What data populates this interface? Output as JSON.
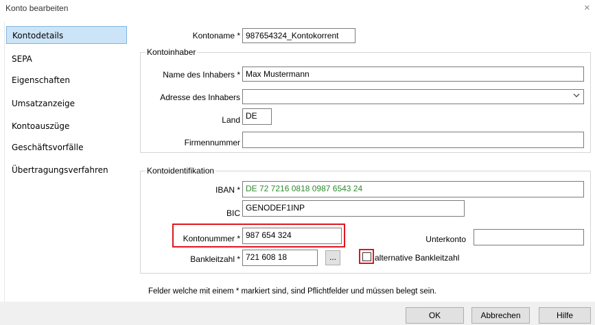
{
  "window": {
    "title": "Konto bearbeiten",
    "close_label": "×"
  },
  "sidebar": {
    "items": [
      {
        "label": "Kontodetails",
        "active": true
      },
      {
        "label": "SEPA"
      },
      {
        "label": "Eigenschaften"
      },
      {
        "label": "Umsatzanzeige"
      },
      {
        "label": "Kontoauszüge"
      },
      {
        "label": "Geschäftsvorfälle"
      },
      {
        "label": "Übertragungsverfahren"
      }
    ]
  },
  "form": {
    "kontoname": {
      "label": "Kontoname *",
      "value": "987654324_Kontokorrent"
    },
    "kontoinhaber": {
      "legend": "Kontoinhaber",
      "name": {
        "label": "Name des Inhabers *",
        "value": "Max Mustermann"
      },
      "adresse": {
        "label": "Adresse des Inhabers",
        "value": "",
        "dropdown_icon": "chevron-down-icon"
      },
      "land": {
        "label": "Land",
        "value": "DE"
      },
      "firmennummer": {
        "label": "Firmennummer",
        "value": ""
      }
    },
    "kontoidentifikation": {
      "legend": "Kontoidentifikation",
      "iban": {
        "label": "IBAN *",
        "value": "DE 72 7216 0818 0987 6543 24",
        "color": "#2e8b2e"
      },
      "bic": {
        "label": "BIC",
        "value": "GENODEF1INP"
      },
      "kontonummer": {
        "label": "Kontonummer *",
        "value": "987 654 324"
      },
      "unterkonto": {
        "label": "Unterkonto",
        "value": ""
      },
      "bankleitzahl": {
        "label": "Bankleitzahl *",
        "value": "721 608 18",
        "browse_label": "..."
      },
      "alternative_blz": {
        "label": "alternative Bankleitzahl",
        "checked": false
      }
    },
    "note": "Felder welche mit einem * markiert sind, sind Pflichtfelder und müssen belegt sein."
  },
  "highlight_color": "#e0141c",
  "buttons": {
    "ok": "OK",
    "cancel": "Abbrechen",
    "help": "Hilfe"
  }
}
